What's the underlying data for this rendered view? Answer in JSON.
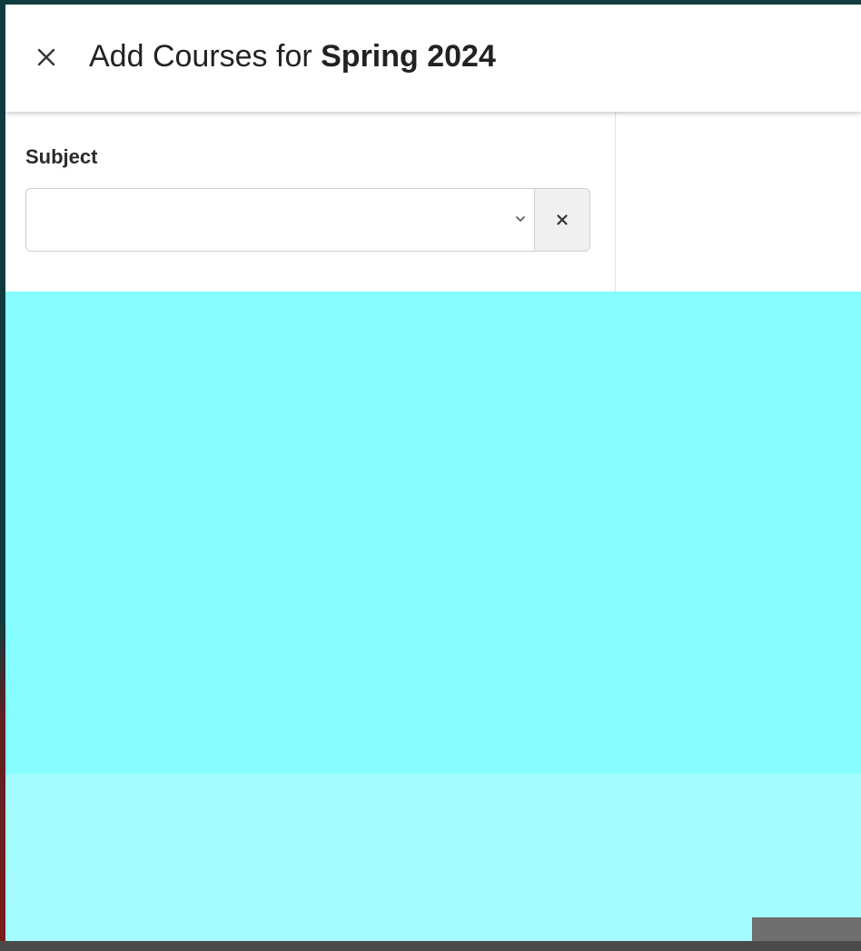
{
  "header": {
    "title_prefix": "Add Courses for ",
    "term": "Spring 2024"
  },
  "form": {
    "subject_label": "Subject",
    "subject_value": ""
  }
}
